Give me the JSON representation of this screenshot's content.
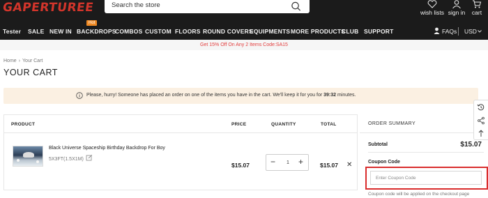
{
  "brand": {
    "logo_text": "GAPERTUREE",
    "accent": "#d2352b"
  },
  "search": {
    "placeholder": "Search the store"
  },
  "account": {
    "wishlist": "wish lists",
    "signin": "sign in",
    "cart": "cart"
  },
  "nav": {
    "items": [
      "Tester",
      "SALE",
      "NEW IN",
      "BACKDROPS",
      "COMBOS",
      "CUSTOM",
      "FLOORS",
      "ROUND COVERS",
      "EQUIPMENTS",
      "MORE PRODUCTS",
      "CLUB",
      "SUPPORT"
    ],
    "hot_badge": "Hot",
    "faqs": "FAQs",
    "currency": "USD"
  },
  "promo": {
    "text": "Get 15% Off On Any 2 Items Code:SA15"
  },
  "breadcrumb": {
    "home": "Home",
    "current": "Your Cart"
  },
  "page": {
    "title": "YOUR CART"
  },
  "alert": {
    "text": "Please, hurry! Someone has placed an order on one of the items you have in the cart. We'll keep it for you for",
    "time": "39:32",
    "suffix": "minutes."
  },
  "table": {
    "headers": {
      "product": "PRODUCT",
      "price": "PRICE",
      "quantity": "QUANTITY",
      "total": "TOTAL"
    },
    "row": {
      "name": "Black Universe Spaceship Birthday Backdrop For Boy",
      "variant": "5X3FT(1.5X1M)",
      "price": "$15.07",
      "quantity": "1",
      "total": "$15.07"
    }
  },
  "summary": {
    "title": "ORDER SUMMARY",
    "subtotal_label": "Subtotal",
    "subtotal_value": "$15.07",
    "coupon_label": "Coupon Code",
    "coupon_placeholder": "Enter Coupon Code",
    "coupon_note": "Coupon code will be applied on the checkout page"
  }
}
